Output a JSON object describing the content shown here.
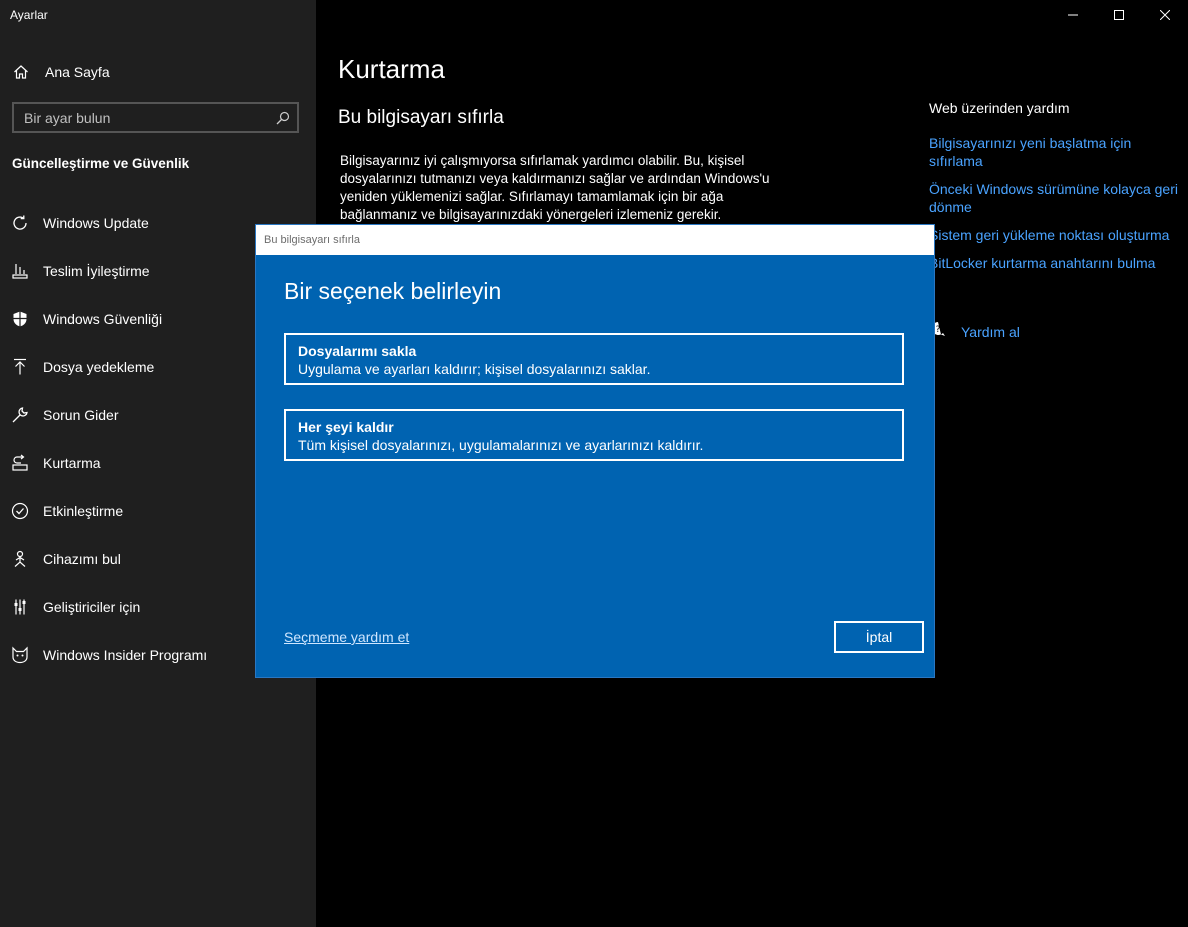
{
  "app": {
    "title": "Ayarlar"
  },
  "sidebar": {
    "home_label": "Ana Sayfa",
    "search_placeholder": "Bir ayar bulun",
    "section_title": "Güncelleştirme ve Güvenlik",
    "items": [
      {
        "label": "Windows Update",
        "icon": "refresh-icon"
      },
      {
        "label": "Teslim İyileştirme",
        "icon": "delivery-icon"
      },
      {
        "label": "Windows Güvenliği",
        "icon": "shield-icon"
      },
      {
        "label": "Dosya yedekleme",
        "icon": "backup-arrow-icon"
      },
      {
        "label": "Sorun Gider",
        "icon": "wrench-icon"
      },
      {
        "label": "Kurtarma",
        "icon": "recovery-icon"
      },
      {
        "label": "Etkinleştirme",
        "icon": "check-circle-icon"
      },
      {
        "label": "Cihazımı bul",
        "icon": "person-pin-icon"
      },
      {
        "label": "Geliştiriciler için",
        "icon": "sliders-icon"
      },
      {
        "label": "Windows Insider Programı",
        "icon": "cat-icon"
      }
    ]
  },
  "main": {
    "page_title": "Kurtarma",
    "sub_title": "Bu bilgisayarı sıfırla",
    "description": "Bilgisayarınız iyi çalışmıyorsa sıfırlamak yardımcı olabilir. Bu, kişisel dosyalarınızı tutmanızı veya kaldırmanızı sağlar ve ardından Windows'u yeniden yüklemenizi sağlar. Sıfırlamayı tamamlamak için bir ağa bağlanmanız ve bilgisayarınızdaki yönergeleri izlemeniz gerekir.",
    "web_help_header": "Web üzerinden yardım",
    "web_links": [
      "Bilgisayarınızı yeni başlatma için sıfırlama",
      "Önceki Windows sürümüne kolayca geri dönme",
      "Sistem geri yükleme noktası oluşturma",
      "BitLocker kurtarma anahtarını bulma"
    ],
    "get_help": "Yardım al"
  },
  "dialog": {
    "title": "Bu bilgisayarı sıfırla",
    "heading": "Bir seçenek belirleyin",
    "options": [
      {
        "title": "Dosyalarımı sakla",
        "desc": "Uygulama ve ayarları kaldırır; kişisel dosyalarınızı saklar."
      },
      {
        "title": "Her şeyi kaldır",
        "desc": "Tüm kişisel dosyalarınızı, uygulamalarınızı ve ayarlarınızı kaldırır."
      }
    ],
    "help_link": "Seçmeme yardım et",
    "cancel_label": "İptal"
  },
  "colors": {
    "accent": "#0063b1",
    "link": "#4aa3ff",
    "sidebar": "#1f1f1f"
  }
}
